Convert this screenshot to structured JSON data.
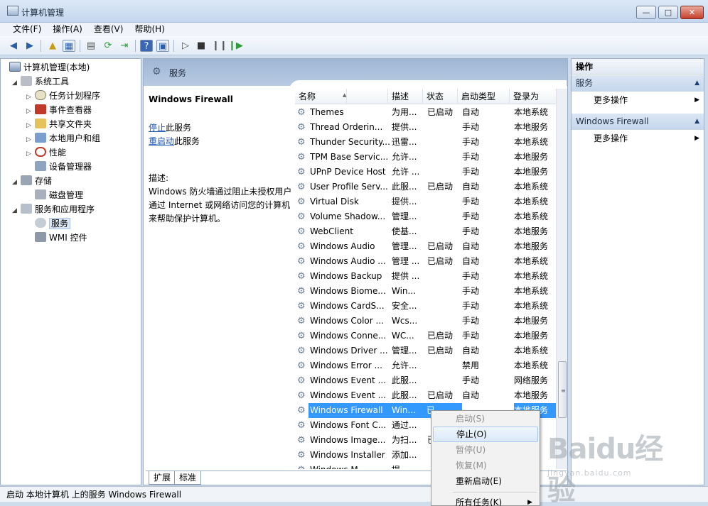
{
  "window": {
    "title": "计算机管理"
  },
  "menu": [
    "文件(F)",
    "操作(A)",
    "查看(V)",
    "帮助(H)"
  ],
  "tree": {
    "root": "计算机管理(本地)",
    "system_tools": "系统工具",
    "task_scheduler": "任务计划程序",
    "event_viewer": "事件查看器",
    "shared_folders": "共享文件夹",
    "local_users": "本地用户和组",
    "performance": "性能",
    "device_manager": "设备管理器",
    "storage": "存储",
    "disk_management": "磁盘管理",
    "services_apps": "服务和应用程序",
    "services": "服务",
    "wmi": "WMI 控件"
  },
  "middle": {
    "header_title": "服务",
    "selected_name": "Windows Firewall",
    "stop_link": "停止",
    "stop_suffix": "此服务",
    "restart_link": "重启动",
    "restart_suffix": "此服务",
    "desc_label": "描述:",
    "desc_line1": "Windows 防火墙通过阻止未授权用户",
    "desc_line2": "通过 Internet 或网络访问您的计算机",
    "desc_line3": "来帮助保护计算机。"
  },
  "list": {
    "col_name": "名称",
    "col_desc": "描述",
    "col_state": "状态",
    "col_start": "启动类型",
    "col_logon": "登录为",
    "rows": [
      {
        "name": "Themes",
        "desc": "为用...",
        "state": "已启动",
        "start": "自动",
        "logon": "本地系统"
      },
      {
        "name": "Thread Orderin...",
        "desc": "提供...",
        "state": "",
        "start": "手动",
        "logon": "本地服务"
      },
      {
        "name": "Thunder Security...",
        "desc": "迅雷...",
        "state": "",
        "start": "手动",
        "logon": "本地系统"
      },
      {
        "name": "TPM Base Servic...",
        "desc": "允许...",
        "state": "",
        "start": "手动",
        "logon": "本地服务"
      },
      {
        "name": "UPnP Device Host",
        "desc": "允许 ...",
        "state": "",
        "start": "手动",
        "logon": "本地服务"
      },
      {
        "name": "User Profile Serv...",
        "desc": "此服...",
        "state": "已启动",
        "start": "自动",
        "logon": "本地系统"
      },
      {
        "name": "Virtual Disk",
        "desc": "提供...",
        "state": "",
        "start": "手动",
        "logon": "本地系统"
      },
      {
        "name": "Volume Shadow...",
        "desc": "管理...",
        "state": "",
        "start": "手动",
        "logon": "本地系统"
      },
      {
        "name": "WebClient",
        "desc": "使基...",
        "state": "",
        "start": "手动",
        "logon": "本地服务"
      },
      {
        "name": "Windows Audio",
        "desc": "管理...",
        "state": "已启动",
        "start": "自动",
        "logon": "本地服务"
      },
      {
        "name": "Windows Audio ...",
        "desc": "管理 ...",
        "state": "已启动",
        "start": "自动",
        "logon": "本地系统"
      },
      {
        "name": "Windows Backup",
        "desc": "提供 ...",
        "state": "",
        "start": "手动",
        "logon": "本地系统"
      },
      {
        "name": "Windows Biome...",
        "desc": "Win...",
        "state": "",
        "start": "手动",
        "logon": "本地系统"
      },
      {
        "name": "Windows CardS...",
        "desc": "安全...",
        "state": "",
        "start": "手动",
        "logon": "本地系统"
      },
      {
        "name": "Windows Color ...",
        "desc": "Wcs...",
        "state": "",
        "start": "手动",
        "logon": "本地服务"
      },
      {
        "name": "Windows Conne...",
        "desc": "WC...",
        "state": "已启动",
        "start": "手动",
        "logon": "本地服务"
      },
      {
        "name": "Windows Driver ...",
        "desc": "管理...",
        "state": "已启动",
        "start": "自动",
        "logon": "本地系统"
      },
      {
        "name": "Windows Error ...",
        "desc": "允许...",
        "state": "",
        "start": "禁用",
        "logon": "本地系统"
      },
      {
        "name": "Windows Event ...",
        "desc": "此服...",
        "state": "",
        "start": "手动",
        "logon": "网络服务"
      },
      {
        "name": "Windows Event ...",
        "desc": "此服...",
        "state": "已启动",
        "start": "自动",
        "logon": "本地服务"
      },
      {
        "name": "Windows Firewall",
        "desc": "Win...",
        "state": "已",
        "start": "",
        "logon": "本地服务"
      },
      {
        "name": "Windows Font C...",
        "desc": "通过...",
        "state": "",
        "start": "",
        "logon": "服务"
      },
      {
        "name": "Windows Image...",
        "desc": "为扫...",
        "state": "已",
        "start": "",
        "logon": "服务"
      },
      {
        "name": "Windows Installer",
        "desc": "添加...",
        "state": "",
        "start": "",
        "logon": "系统"
      },
      {
        "name": "Windows M...",
        "desc": "提...",
        "state": "",
        "start": "",
        "logon": ""
      }
    ]
  },
  "tabs": {
    "extended": "扩展",
    "standard": "标准"
  },
  "actions": {
    "title": "操作",
    "group1": "服务",
    "group1_more": "更多操作",
    "group2": "Windows Firewall",
    "group2_more": "更多操作"
  },
  "context_menu": {
    "start": "启动(S)",
    "stop": "停止(O)",
    "pause": "暂停(U)",
    "resume": "恢复(M)",
    "restart": "重新启动(E)",
    "all_tasks": "所有任务(K)"
  },
  "status": "启动 本地计算机 上的服务 Windows Firewall",
  "watermark": {
    "text": "Baidu经验",
    "url": "jingyan.baidu.com"
  }
}
